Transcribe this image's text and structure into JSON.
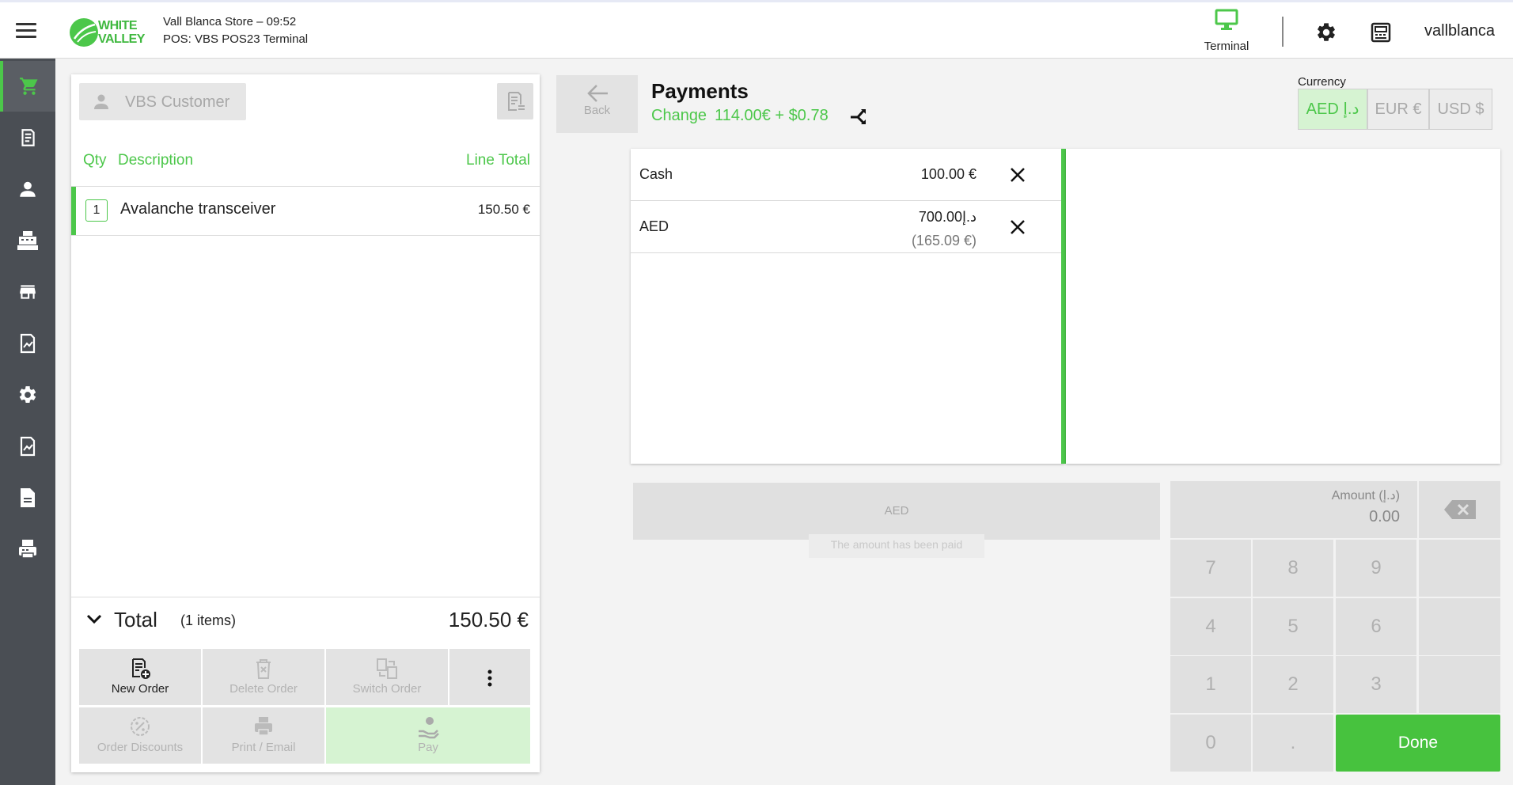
{
  "header": {
    "logo_line1": "WHITE",
    "logo_line2": "VALLEY",
    "store_line": "Vall Blanca Store – 09:52",
    "pos_line": "POS: VBS POS23 Terminal",
    "terminal_label": "Terminal",
    "username": "vallblanca"
  },
  "sidebar": {
    "items": [
      {
        "icon": "cart-icon",
        "active": true
      },
      {
        "icon": "receipt-icon"
      },
      {
        "icon": "user-icon"
      },
      {
        "icon": "cash-register-icon"
      },
      {
        "icon": "store-icon"
      },
      {
        "icon": "report-icon"
      },
      {
        "icon": "gear-icon"
      },
      {
        "icon": "report-icon"
      },
      {
        "icon": "document-icon"
      },
      {
        "icon": "printer-icon"
      }
    ]
  },
  "order": {
    "customer": "VBS Customer",
    "columns": {
      "qty": "Qty",
      "description": "Description",
      "line_total": "Line Total"
    },
    "lines": [
      {
        "qty": "1",
        "description": "Avalanche transceiver",
        "total": "150.50 €"
      }
    ],
    "total_label": "Total",
    "items_count": "(1 items)",
    "total_amount": "150.50 €",
    "actions": {
      "new_order": "New Order",
      "delete_order": "Delete Order",
      "switch_order": "Switch Order",
      "order_discounts": "Order Discounts",
      "print_email": "Print / Email",
      "pay": "Pay"
    }
  },
  "payments": {
    "back_label": "Back",
    "title": "Payments",
    "change_label": "Change",
    "change_value": "114.00€ + $0.78",
    "currency_label": "Currency",
    "currencies": [
      {
        "label": "AED د.إ",
        "active": true
      },
      {
        "label": "EUR €",
        "active": false
      },
      {
        "label": "USD $",
        "active": false
      }
    ],
    "rows": [
      {
        "name": "Cash",
        "amount": "100.00 €",
        "sub": ""
      },
      {
        "name": "AED",
        "amount": "700.00د.إ",
        "sub": "(165.09 €)"
      }
    ],
    "method_button": "AED",
    "paid_message": "The amount has been paid"
  },
  "keypad": {
    "amount_label": "Amount (د.إ)",
    "amount_value": "0.00",
    "keys": [
      "7",
      "8",
      "9",
      "4",
      "5",
      "6",
      "1",
      "2",
      "3",
      "0",
      "."
    ],
    "done_label": "Done"
  },
  "colors": {
    "accent": "#4cc74a",
    "sidebar": "#4a4e54",
    "done": "#47c23e"
  }
}
